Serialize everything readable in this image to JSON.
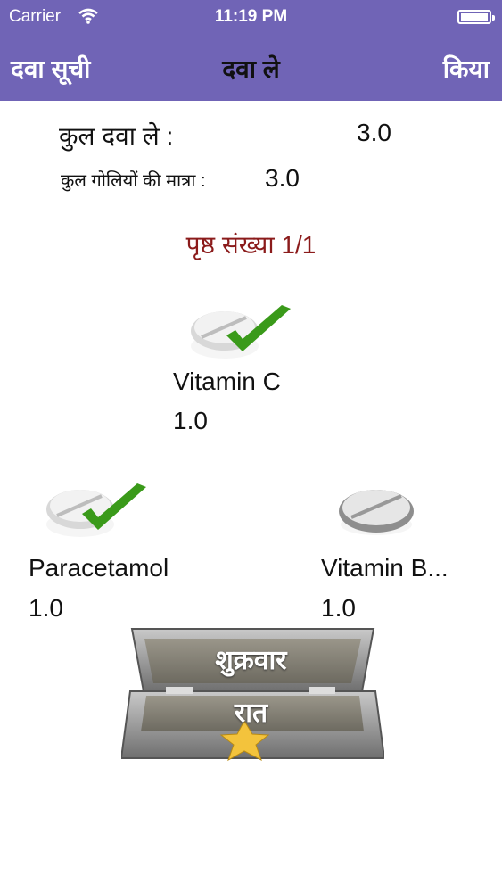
{
  "status_bar": {
    "carrier": "Carrier",
    "time": "11:19 PM"
  },
  "nav": {
    "back_label": "दवा सूची",
    "title": "दवा ले",
    "done_label": "किया"
  },
  "summary": {
    "total_label": "कुल दवा ले :",
    "total_value": "3.0",
    "pills_label": "कुल गोलियों की मात्रा :",
    "pills_value": "3.0"
  },
  "page_number": "पृष्ठ संख्या 1/1",
  "medicines": [
    {
      "name": "Vitamin C",
      "dose": "1.0",
      "taken": true
    },
    {
      "name": "Paracetamol",
      "dose": "1.0",
      "taken": true
    },
    {
      "name": "Vitamin B...",
      "dose": "1.0",
      "taken": false
    }
  ],
  "pillbox": {
    "day": "शुक्रवार",
    "time_of_day": "रात"
  },
  "colors": {
    "header_bg": "#7064b6",
    "page_number": "#8b1b1b",
    "check": "#3a9a1a"
  }
}
